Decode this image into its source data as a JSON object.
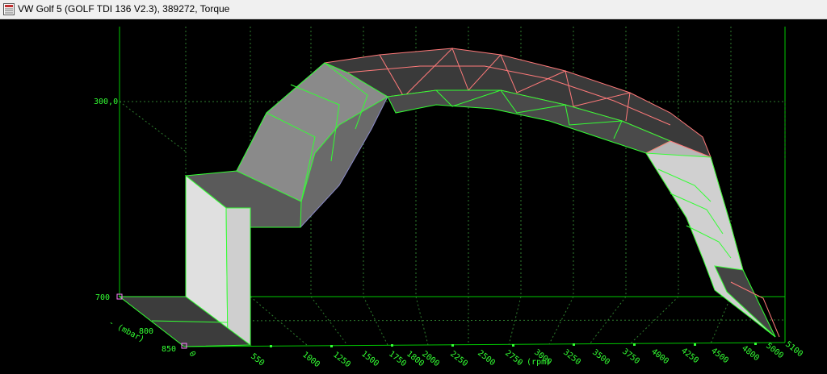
{
  "window": {
    "title": "VW Golf 5 (GOLF TDI 136 V2.3), 389272, Torque",
    "icon": "map-window-icon"
  },
  "plot": {
    "colors": {
      "background": "#000000",
      "axis": "#00c800",
      "grid": "#2e8b2e",
      "edge_front": "#33ff33",
      "edge_back": "#ff8080",
      "surface": "#5a5a5a",
      "surface_light": "#d8d8d8"
    },
    "z_axis": {
      "label_high": "300,0",
      "label_low": "700"
    },
    "pressure_axis": {
      "label": "- (mbar)",
      "ticks": [
        "800",
        "850"
      ],
      "end": "0"
    },
    "rpm_axis": {
      "label": "- (rpm)",
      "ticks": [
        "550",
        "1000",
        "1250",
        "1500",
        "1750",
        "1800",
        "2000",
        "2250",
        "2500",
        "2750",
        "3000",
        "3250",
        "3500",
        "3750",
        "4000",
        "4250",
        "4500",
        "4800",
        "5000",
        "5100"
      ]
    }
  }
}
